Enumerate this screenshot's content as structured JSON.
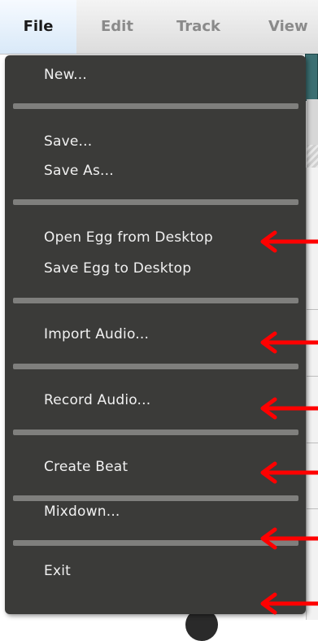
{
  "menubar": {
    "items": [
      {
        "label": "File"
      },
      {
        "label": "Edit"
      },
      {
        "label": "Track"
      },
      {
        "label": "View"
      }
    ]
  },
  "file_menu": {
    "items": [
      {
        "label": "New..."
      },
      {
        "label": "Save..."
      },
      {
        "label": "Save As..."
      },
      {
        "label": "Open Egg from Desktop"
      },
      {
        "label": "Save Egg to Desktop"
      },
      {
        "label": "Import Audio..."
      },
      {
        "label": "Record Audio..."
      },
      {
        "label": "Create Beat"
      },
      {
        "label": "Mixdown..."
      },
      {
        "label": "Exit"
      }
    ]
  },
  "colors": {
    "menu_background": "#3b3b39",
    "separator": "#7f7f7d",
    "menu_text": "#f1f1f1",
    "annotation_arrow": "#ff0000",
    "menubar_active": "#d9e9f8"
  },
  "annotations": {
    "arrow_icon": "left-arrow",
    "arrow_count": 6
  }
}
